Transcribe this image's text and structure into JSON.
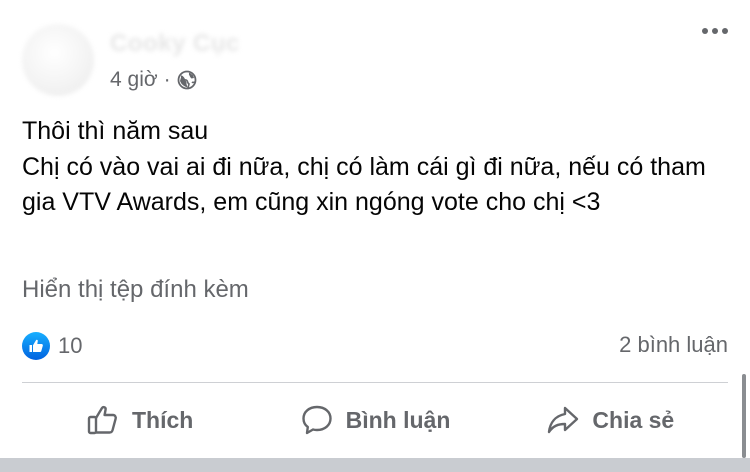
{
  "post": {
    "author": "Cooky Cục",
    "time": "4 giờ",
    "separator": "·",
    "privacy_icon": "globe-icon",
    "more_icon": "more-options-icon",
    "body_lines": [
      "Thôi thì năm sau",
      "Chị có vào vai ai đi nữa, chị có làm cái gì đi nữa, nếu có tham gia VTV Awards, em cũng xin ngóng vote cho chị <3"
    ],
    "attachment_link": "Hiển thị tệp đính kèm",
    "reaction_icon": "like-reaction-icon",
    "reaction_count": "10",
    "comment_count": "2 bình luận"
  },
  "actions": {
    "like_label": "Thích",
    "comment_label": "Bình luận",
    "share_label": "Chia sẻ"
  },
  "colors": {
    "text_primary": "#050505",
    "text_secondary": "#65676b",
    "like_blue": "#0062df",
    "divider": "#ced0d4"
  }
}
